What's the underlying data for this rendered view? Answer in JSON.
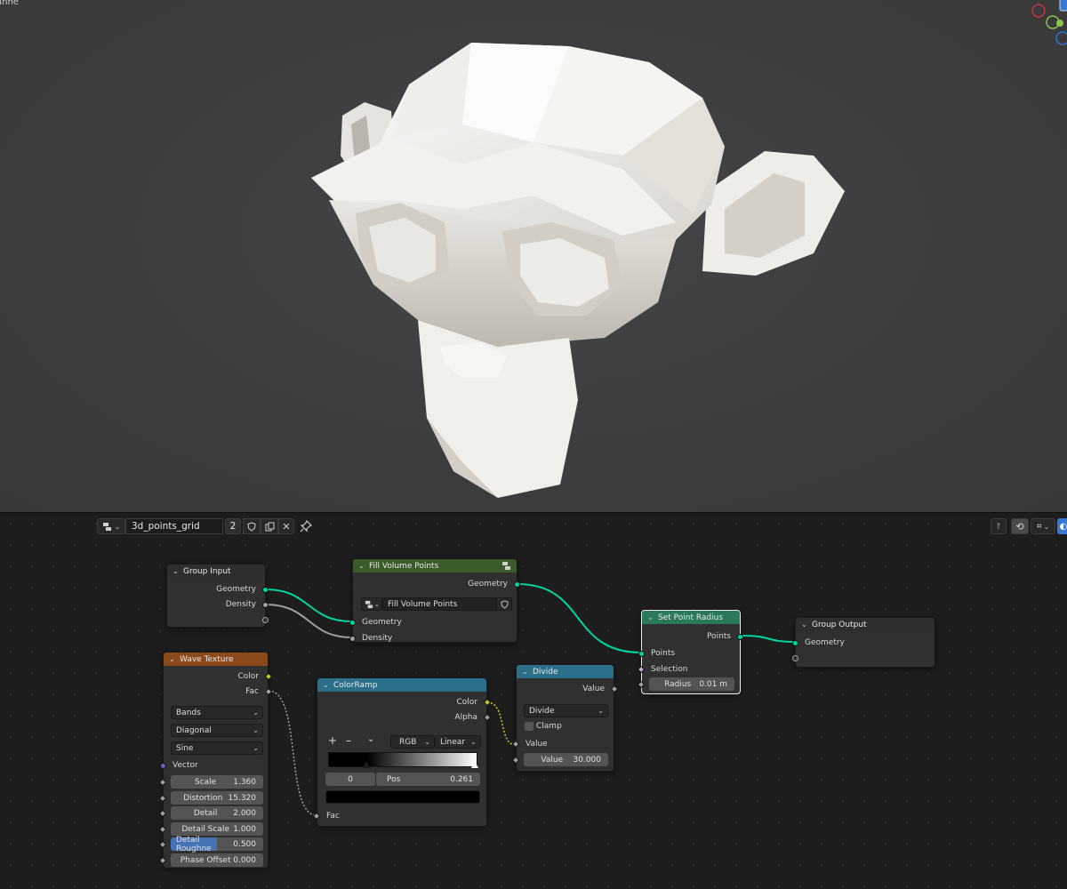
{
  "viewport": {
    "object_label": "anne",
    "colors": {
      "bg": "#3d3d3d",
      "gizmo_x": "#c8333e",
      "gizmo_y": "#8bc34a",
      "gizmo_z": "#2f6fd6"
    }
  },
  "editor_header": {
    "tree_name": "3d_points_grid",
    "user_count": "2"
  },
  "nodes": {
    "group_input": {
      "title": "Group Input",
      "outputs": [
        "Geometry",
        "Density"
      ]
    },
    "fill_volume": {
      "title": "Fill Volume Points",
      "output": "Geometry",
      "data_block": "Fill Volume Points",
      "inputs": [
        "Geometry",
        "Density"
      ]
    },
    "set_radius": {
      "title": "Set Point Radius",
      "output": "Points",
      "inputs": [
        "Points",
        "Selection"
      ],
      "radius_label": "Radius",
      "radius_value": "0.01 m"
    },
    "group_output": {
      "title": "Group Output",
      "input": "Geometry"
    },
    "wave": {
      "title": "Wave Texture",
      "outputs": [
        "Color",
        "Fac"
      ],
      "wave_type": "Bands",
      "direction": "Diagonal",
      "profile": "Sine",
      "vector_label": "Vector",
      "params": [
        {
          "label": "Scale",
          "value": "1.360"
        },
        {
          "label": "Distortion",
          "value": "15.320"
        },
        {
          "label": "Detail",
          "value": "2.000"
        },
        {
          "label": "Detail Scale",
          "value": "1.000"
        },
        {
          "label": "Detail Roughne",
          "value": "0.500"
        },
        {
          "label": "Phase Offset",
          "value": "0.000"
        }
      ]
    },
    "colorramp": {
      "title": "ColorRamp",
      "outputs": [
        "Color",
        "Alpha"
      ],
      "add": "+",
      "remove": "–",
      "color_mode": "RGB",
      "interpolation": "Linear",
      "stop_index": "0",
      "pos_label": "Pos",
      "pos_value": "0.261",
      "input": "Fac"
    },
    "divide": {
      "title": "Divide",
      "output": "Value",
      "operation": "Divide",
      "clamp_label": "Clamp",
      "input": "Value",
      "value_label": "Value",
      "value": "30.000"
    }
  },
  "colors": {
    "geometry_header": "#3b5c2a",
    "texture_header": "#8a4a1c",
    "converter_header": "#2c6f8a",
    "set_radius_header": "#2a7a5a",
    "input_header": "#2e2e2e",
    "link_geometry": "#00d6a3",
    "link_float": "#a1a1a1",
    "link_color": "#c7c729"
  }
}
